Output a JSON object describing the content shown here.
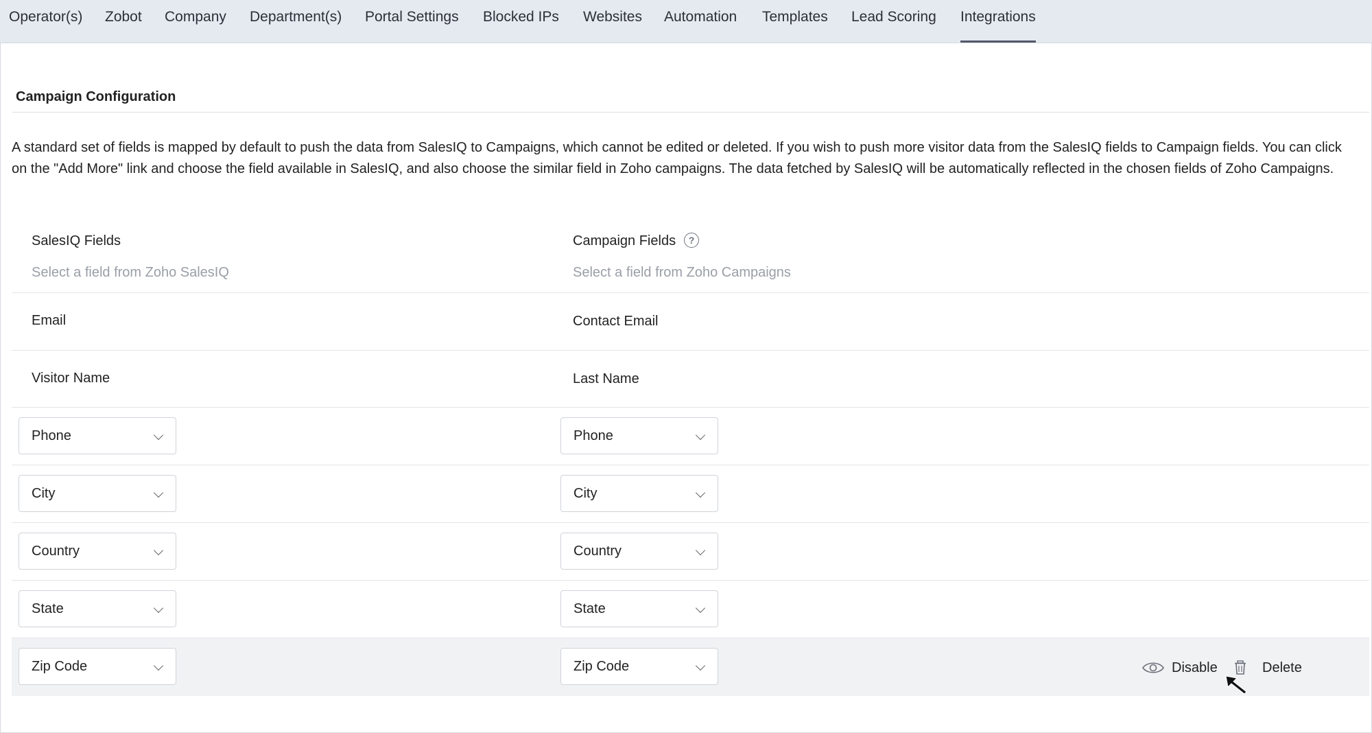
{
  "tabs": [
    {
      "label": "Operator(s)",
      "active": false
    },
    {
      "label": "Zobot",
      "active": false
    },
    {
      "label": "Company",
      "active": false
    },
    {
      "label": "Department(s)",
      "active": false
    },
    {
      "label": "Portal Settings",
      "active": false
    },
    {
      "label": "Blocked IPs",
      "active": false
    },
    {
      "label": "Websites",
      "active": false
    },
    {
      "label": "Automation",
      "active": false
    },
    {
      "label": "Templates",
      "active": false
    },
    {
      "label": "Lead Scoring",
      "active": false
    },
    {
      "label": "Integrations",
      "active": true
    }
  ],
  "section": {
    "title": "Campaign Configuration",
    "description": "A standard set of fields is mapped by default to push the data from SalesIQ to Campaigns, which cannot be edited or deleted. If you wish to push more visitor data from the SalesIQ fields to Campaign fields. You can click on the \"Add More\" link and choose the field available in SalesIQ, and also choose the similar field in Zoho campaigns. The data fetched by SalesIQ will be automatically reflected in the chosen fields of Zoho Campaigns."
  },
  "mapping": {
    "salesiq_header": "SalesIQ Fields",
    "salesiq_placeholder": "Select a field from Zoho SalesIQ",
    "campaign_header": "Campaign Fields",
    "campaign_placeholder": "Select a field from Zoho Campaigns",
    "help_icon": "question-circle-icon",
    "default_rows": [
      {
        "salesiq": "Email",
        "campaign": "Contact Email"
      },
      {
        "salesiq": "Visitor Name",
        "campaign": "Last Name"
      }
    ],
    "custom_rows": [
      {
        "salesiq": "Phone",
        "campaign": "Phone"
      },
      {
        "salesiq": "City",
        "campaign": "City"
      },
      {
        "salesiq": "Country",
        "campaign": "Country"
      },
      {
        "salesiq": "State",
        "campaign": "State"
      },
      {
        "salesiq": "Zip Code",
        "campaign": "Zip Code"
      }
    ]
  },
  "row_actions": {
    "disable_label": "Disable",
    "disable_icon": "eye-icon",
    "delete_label": "Delete",
    "delete_icon": "trash-icon"
  },
  "colors": {
    "tabbar_bg": "#e5e9f0",
    "active_tab_underline": "#52596a",
    "placeholder": "#9a9ea6",
    "hover_row_bg": "#f1f2f4"
  }
}
